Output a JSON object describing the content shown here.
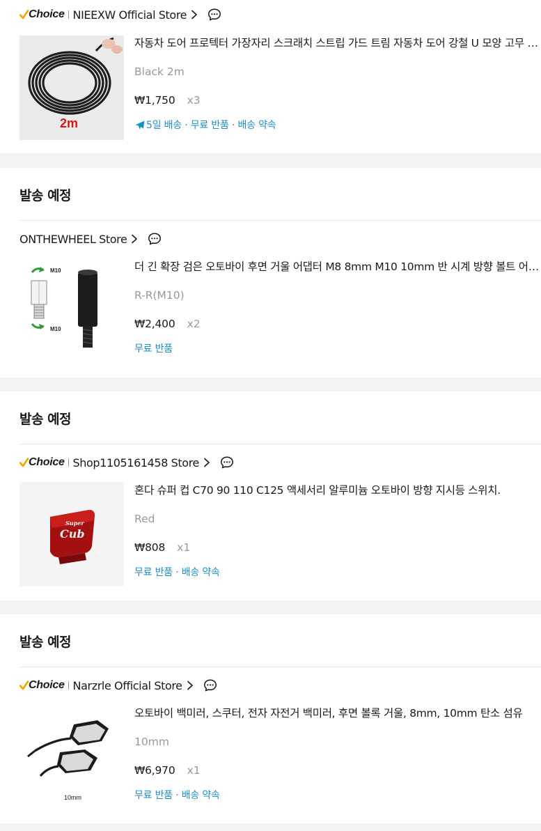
{
  "colors": {
    "accent_blue": "#1a8ec9",
    "choice_check": "#f7a400",
    "muted": "#999999",
    "text": "#191919"
  },
  "sections": [
    {
      "header": "",
      "choice": {
        "label": "Choice"
      },
      "store_name": "NIEEXW Official Store",
      "item": {
        "image_label": "2m",
        "image": "black-rubber-edge-strip-roll",
        "title": "자동차 도어 프로텍터 가장자리 스크래치 스트립 가드 트림 자동차 도어 강철 U 모양 고무 씰 스트립",
        "variant": "Black 2m",
        "price": "₩1,750",
        "qty": "x3",
        "tags": "5일 배송 · 무료 반품 · 배송 약속",
        "tag_icon": "airplane-icon"
      }
    },
    {
      "header": "발송 예정",
      "choice": null,
      "store_name": "ONTHEWHEEL Store",
      "item": {
        "image_label_top": "M10",
        "image_label_bottom": "M10",
        "image": "mirror-adapter-bolt",
        "title": "더 긴 확장 검은 오토바이 후면 거울 어댑터 M8 8mm M10 10mm 반 시계 방향 볼트 어댑터",
        "variant": "R-R(M10)",
        "price": "₩2,400",
        "qty": "x2",
        "tags": "무료 반품"
      }
    },
    {
      "header": "발송 예정",
      "choice": {
        "label": "Choice"
      },
      "store_name": "Shop1105161458 Store",
      "item": {
        "image_label_1": "Super",
        "image_label_2": "Cub",
        "image": "red-aluminum-switch-cap",
        "title": "혼다 슈퍼 컵 C70 90 110 C125 액세서리 알루미늄 오토바이 방향 지시등 스위치.",
        "variant": "Red",
        "price": "₩808",
        "qty": "x1",
        "tags": "무료 반품 · 배송 약속"
      }
    },
    {
      "header": "발송 예정",
      "choice": {
        "label": "Choice"
      },
      "store_name": "Narzrle Official Store",
      "item": {
        "image_label": "10mm",
        "image": "motorcycle-mirrors-pair",
        "title": "오토바이 백미러, 스쿠터, 전자 자전거 백미러, 후면 볼록 거울, 8mm, 10mm 탄소 섬유",
        "variant": "10mm",
        "price": "₩6,970",
        "qty": "x1",
        "tags": "무료 반품 · 배송 약속"
      }
    }
  ]
}
